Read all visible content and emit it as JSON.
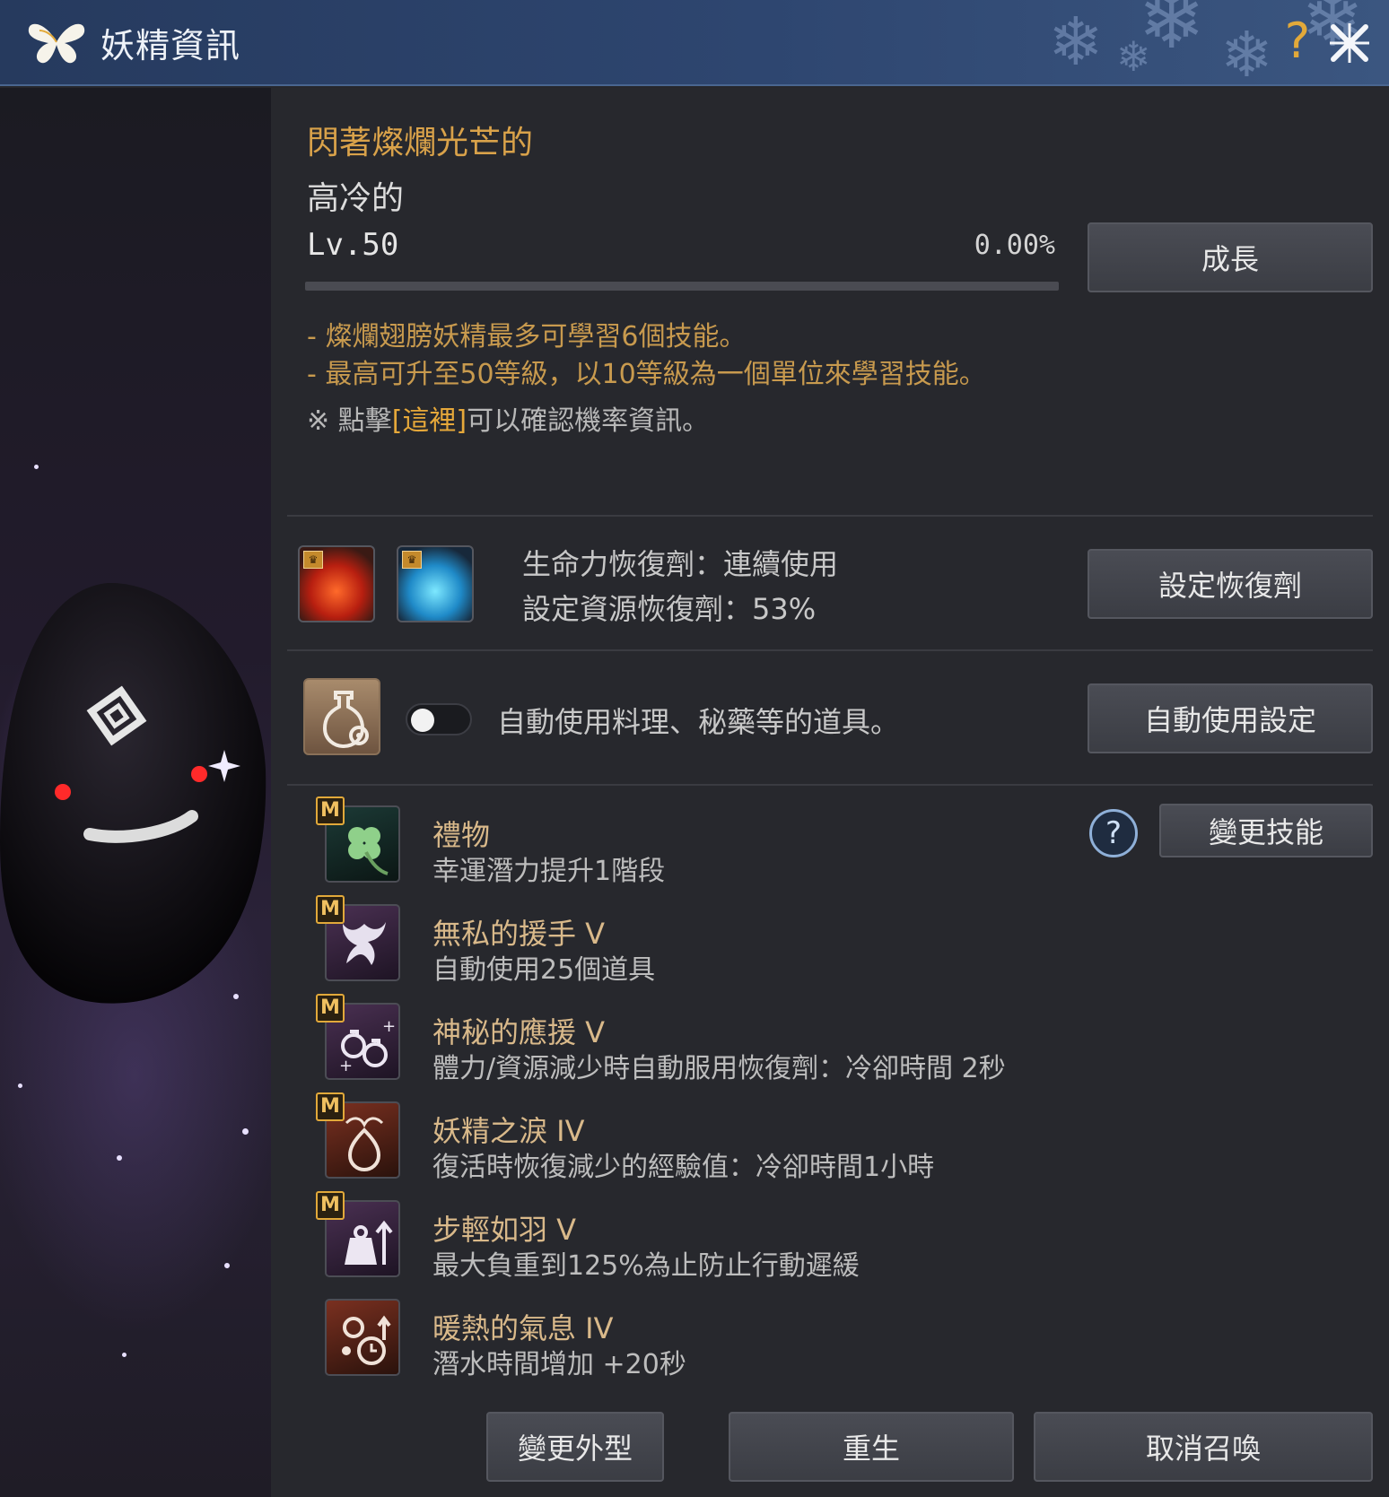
{
  "window": {
    "title": "妖精資訊",
    "help_glyph": "?"
  },
  "fairy": {
    "title_line1": "閃著燦爛光芒的",
    "title_line2": "高冷的",
    "level": "Lv.50",
    "exp_percent": "0.00%",
    "exp_fraction": 0.0,
    "grow_button": "成長"
  },
  "notes": {
    "line1": "- 燦爛翅膀妖精最多可學習6個技能。",
    "line2": "- 最高可升至50等級，以10等級為一個單位來學習技能。",
    "line3_prefix": "※ 點擊",
    "line3_link": "[這裡]",
    "line3_suffix": "可以確認機率資訊。"
  },
  "recovery": {
    "hp_label": "生命力恢復劑：連續使用",
    "resource_label": "設定資源恢復劑：53%",
    "button": "設定恢復劑"
  },
  "auto_use": {
    "text": "自動使用料理、秘藥等的道具。",
    "toggle_on": false,
    "button": "自動使用設定"
  },
  "skills": {
    "change_button": "變更技能",
    "help_glyph": "?",
    "badge": "M",
    "items": [
      {
        "name": "禮物",
        "desc": "幸運潛力提升1階段"
      },
      {
        "name": "無私的援手 V",
        "desc": "自動使用25個道具"
      },
      {
        "name": "神秘的應援 V",
        "desc": "體力/資源減少時自動服用恢復劑：冷卻時間 2秒"
      },
      {
        "name": "妖精之淚 IV",
        "desc": "復活時恢復減少的經驗值：冷卻時間1小時"
      },
      {
        "name": "步輕如羽 V",
        "desc": "最大負重到125%為止防止行動遲緩"
      },
      {
        "name": "暖熱的氣息 IV",
        "desc": "潛水時間增加 +20秒"
      }
    ]
  },
  "footer": {
    "change_look": "變更外型",
    "rebirth": "重生",
    "unsummon": "取消召喚"
  }
}
